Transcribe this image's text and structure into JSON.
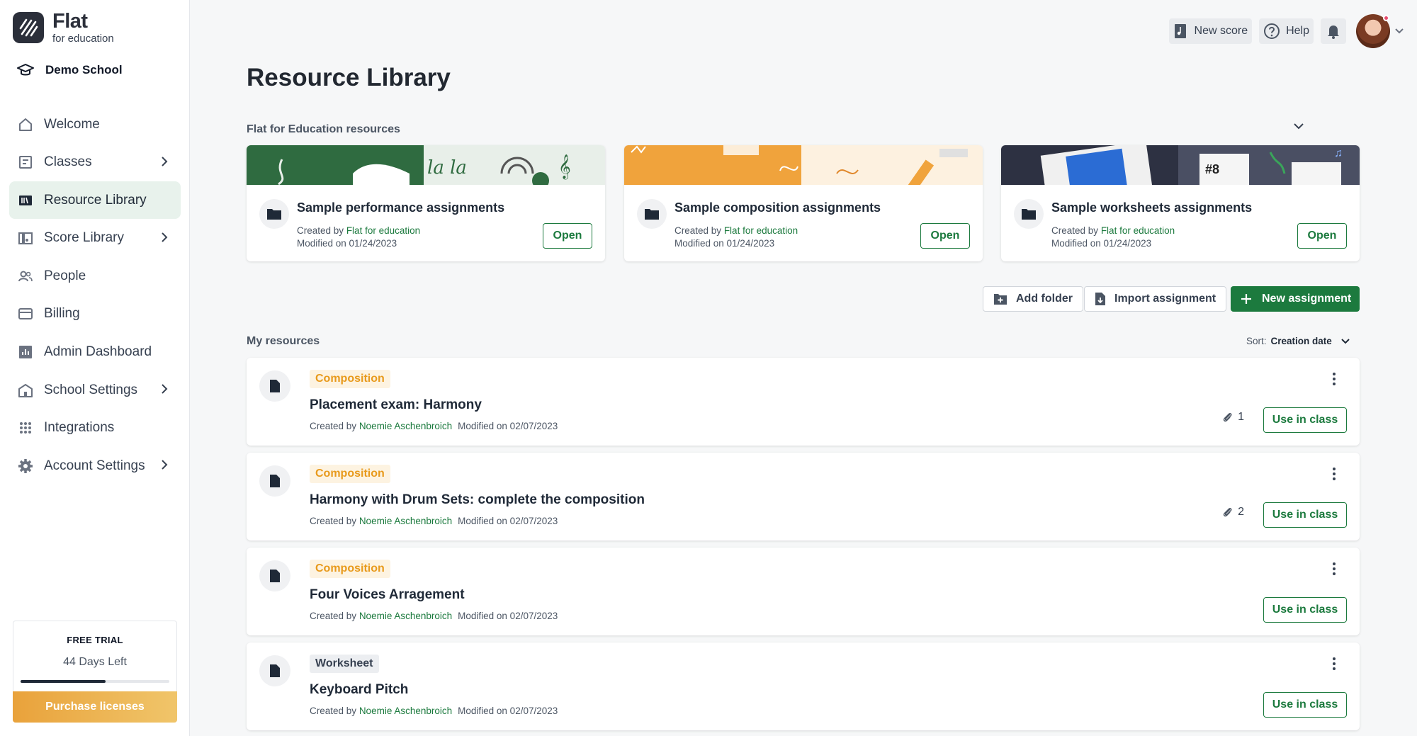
{
  "brand": {
    "name": "Flat",
    "sub": "for education"
  },
  "school": {
    "name": "Demo School"
  },
  "nav": [
    {
      "label": "Welcome",
      "icon": "home-icon",
      "chevron": false,
      "active": false
    },
    {
      "label": "Classes",
      "icon": "classes-icon",
      "chevron": true,
      "active": false
    },
    {
      "label": "Resource Library",
      "icon": "library-icon",
      "chevron": false,
      "active": true
    },
    {
      "label": "Score Library",
      "icon": "score-library-icon",
      "chevron": true,
      "active": false
    },
    {
      "label": "People",
      "icon": "people-icon",
      "chevron": false,
      "active": false
    },
    {
      "label": "Billing",
      "icon": "billing-icon",
      "chevron": false,
      "active": false
    },
    {
      "label": "Admin Dashboard",
      "icon": "dashboard-icon",
      "chevron": false,
      "active": false
    },
    {
      "label": "School Settings",
      "icon": "school-icon",
      "chevron": true,
      "active": false
    },
    {
      "label": "Integrations",
      "icon": "grid-icon",
      "chevron": false,
      "active": false
    },
    {
      "label": "Account Settings",
      "icon": "gear-icon",
      "chevron": true,
      "active": false
    }
  ],
  "trial": {
    "title": "FREE TRIAL",
    "days": "44 Days Left",
    "progress": 0.57,
    "cta": "Purchase licenses"
  },
  "topbar": {
    "new_score": "New score",
    "help": "Help"
  },
  "page": {
    "title": "Resource Library"
  },
  "flat_resources": {
    "label": "Flat for Education resources",
    "cards": [
      {
        "title": "Sample performance assignments",
        "created_prefix": "Created by",
        "author": "Flat for education",
        "modified": "Modified on 01/24/2023",
        "button": "Open"
      },
      {
        "title": "Sample composition assignments",
        "created_prefix": "Created by",
        "author": "Flat for education",
        "modified": "Modified on 01/24/2023",
        "button": "Open"
      },
      {
        "title": "Sample worksheets assignments",
        "created_prefix": "Created by",
        "author": "Flat for education",
        "modified": "Modified on 01/24/2023",
        "button": "Open"
      }
    ]
  },
  "actions": {
    "add_folder": "Add folder",
    "import": "Import assignment",
    "new": "New assignment"
  },
  "my_resources": {
    "label": "My resources",
    "sort_label": "Sort:",
    "sort_value": "Creation date",
    "items": [
      {
        "tag": "Composition",
        "title": "Placement exam: Harmony",
        "created_prefix": "Created by",
        "author": "Noemie Aschenbroich",
        "modified": "Modified on 02/07/2023",
        "attachments": "1",
        "button": "Use in class"
      },
      {
        "tag": "Composition",
        "title": "Harmony with Drum Sets: complete the composition",
        "created_prefix": "Created by",
        "author": "Noemie Aschenbroich",
        "modified": "Modified on 02/07/2023",
        "attachments": "2",
        "button": "Use in class"
      },
      {
        "tag": "Composition",
        "title": "Four Voices Arragement",
        "created_prefix": "Created by",
        "author": "Noemie Aschenbroich",
        "modified": "Modified on 02/07/2023",
        "attachments": "",
        "button": "Use in class"
      },
      {
        "tag": "Worksheet",
        "title": "Keyboard Pitch",
        "created_prefix": "Created by",
        "author": "Noemie Aschenbroich",
        "modified": "Modified on 02/07/2023",
        "attachments": "",
        "button": "Use in class"
      }
    ]
  },
  "colors": {
    "brand_green": "#1c7a3e",
    "composition_tag": "#e89a1c",
    "active_nav_bg": "#e8f2ec"
  }
}
